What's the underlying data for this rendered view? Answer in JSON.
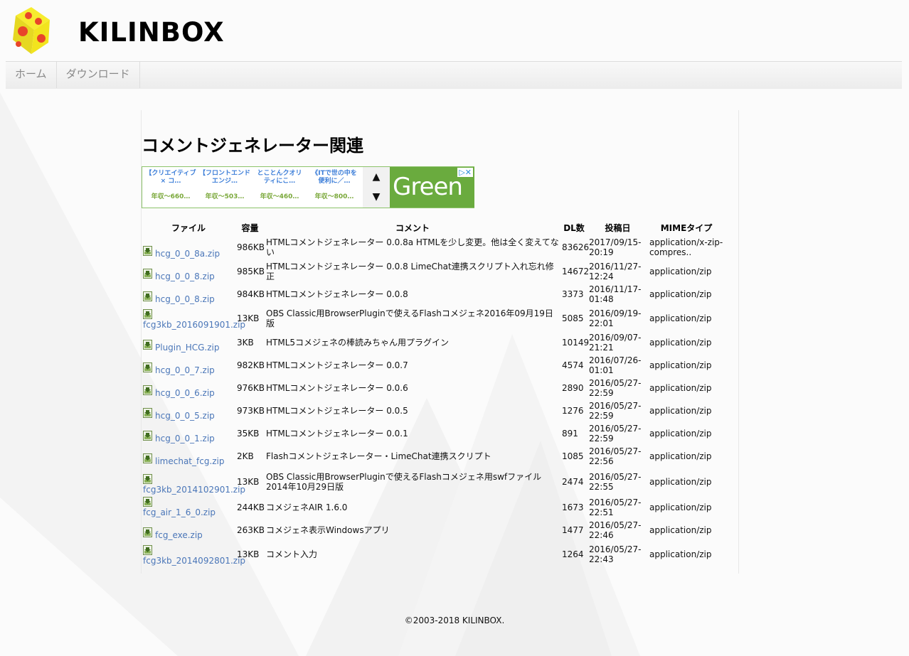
{
  "site": {
    "title": "KILINBOX"
  },
  "nav": {
    "items": [
      {
        "label": "ホーム"
      },
      {
        "label": "ダウンロード"
      }
    ]
  },
  "page": {
    "title": "コメントジェネレーター関連"
  },
  "ad": {
    "jobs": [
      {
        "title": "【クリエイティブ × コ…",
        "salary": "年収〜660…"
      },
      {
        "title": "【フロントエンドエンジ…",
        "salary": "年収〜503…"
      },
      {
        "title": "とことんクオリティにこ…",
        "salary": "年収〜460…"
      },
      {
        "title": "《ITで世の中を便利に／…",
        "salary": "年収〜800…"
      }
    ],
    "up_arrow": "▲",
    "down_arrow": "▼",
    "banner_text": "Green",
    "choices": "▷✕",
    "colors": {
      "border": "#8cc36a",
      "banner": "#6aab3e",
      "job_title": "#3b7dd8"
    }
  },
  "table": {
    "headers": {
      "file": "ファイル",
      "size": "容量",
      "comment": "コメント",
      "dl": "DL数",
      "date": "投稿日",
      "mime": "MIMEタイプ"
    },
    "rows": [
      {
        "file": "hcg_0_0_8a.zip",
        "size": "986KB",
        "comment": "HTMLコメントジェネレーター 0.0.8a HTMLを少し変更。他は全く変えてない",
        "dl": "83626",
        "date": "2017/09/15-20:19",
        "mime": "application/x-zip-compres.."
      },
      {
        "file": "hcg_0_0_8.zip",
        "size": "985KB",
        "comment": "HTMLコメントジェネレーター 0.0.8 LimeChat連携スクリプト入れ忘れ修正",
        "dl": "14672",
        "date": "2016/11/27-12:24",
        "mime": "application/zip"
      },
      {
        "file": "hcg_0_0_8.zip",
        "size": "984KB",
        "comment": "HTMLコメントジェネレーター 0.0.8",
        "dl": "3373",
        "date": "2016/11/17-01:48",
        "mime": "application/zip"
      },
      {
        "file": "fcg3kb_2016091901.zip",
        "size": "13KB",
        "comment": "OBS Classic用BrowserPluginで使えるFlashコメジェネ2016年09月19日版",
        "dl": "5085",
        "date": "2016/09/19-22:01",
        "mime": "application/zip"
      },
      {
        "file": "Plugin_HCG.zip",
        "size": "3KB",
        "comment": "HTML5コメジェネの棒読みちゃん用プラグイン",
        "dl": "10149",
        "date": "2016/09/07-21:21",
        "mime": "application/zip"
      },
      {
        "file": "hcg_0_0_7.zip",
        "size": "982KB",
        "comment": "HTMLコメントジェネレーター 0.0.7",
        "dl": "4574",
        "date": "2016/07/26-01:01",
        "mime": "application/zip"
      },
      {
        "file": "hcg_0_0_6.zip",
        "size": "976KB",
        "comment": "HTMLコメントジェネレーター 0.0.6",
        "dl": "2890",
        "date": "2016/05/27-22:59",
        "mime": "application/zip"
      },
      {
        "file": "hcg_0_0_5.zip",
        "size": "973KB",
        "comment": "HTMLコメントジェネレーター 0.0.5",
        "dl": "1276",
        "date": "2016/05/27-22:59",
        "mime": "application/zip"
      },
      {
        "file": "hcg_0_0_1.zip",
        "size": "35KB",
        "comment": "HTMLコメントジェネレーター 0.0.1",
        "dl": "891",
        "date": "2016/05/27-22:59",
        "mime": "application/zip"
      },
      {
        "file": "limechat_fcg.zip",
        "size": "2KB",
        "comment": "Flashコメントジェネレーター・LimeChat連携スクリプト",
        "dl": "1085",
        "date": "2016/05/27-22:56",
        "mime": "application/zip"
      },
      {
        "file": "fcg3kb_2014102901.zip",
        "size": "13KB",
        "comment": "OBS Classic用BrowserPluginで使えるFlashコメジェネ用swfファイル2014年10月29日版",
        "dl": "2474",
        "date": "2016/05/27-22:55",
        "mime": "application/zip"
      },
      {
        "file": "fcg_air_1_6_0.zip",
        "size": "244KB",
        "comment": "コメジェネAIR 1.6.0",
        "dl": "1673",
        "date": "2016/05/27-22:51",
        "mime": "application/zip"
      },
      {
        "file": "fcg_exe.zip",
        "size": "263KB",
        "comment": "コメジェネ表示Windowsアプリ",
        "dl": "1477",
        "date": "2016/05/27-22:46",
        "mime": "application/zip"
      },
      {
        "file": "fcg3kb_2014092801.zip",
        "size": "13KB",
        "comment": "コメント入力",
        "dl": "1264",
        "date": "2016/05/27-22:43",
        "mime": "application/zip"
      }
    ],
    "file_icon": "download-file-icon"
  },
  "footer": {
    "copyright": "©2003-2018 KILINBOX."
  },
  "colors": {
    "link": "#4a76b8",
    "nav_text": "#888888",
    "page_bg": "#fbfbfb"
  }
}
